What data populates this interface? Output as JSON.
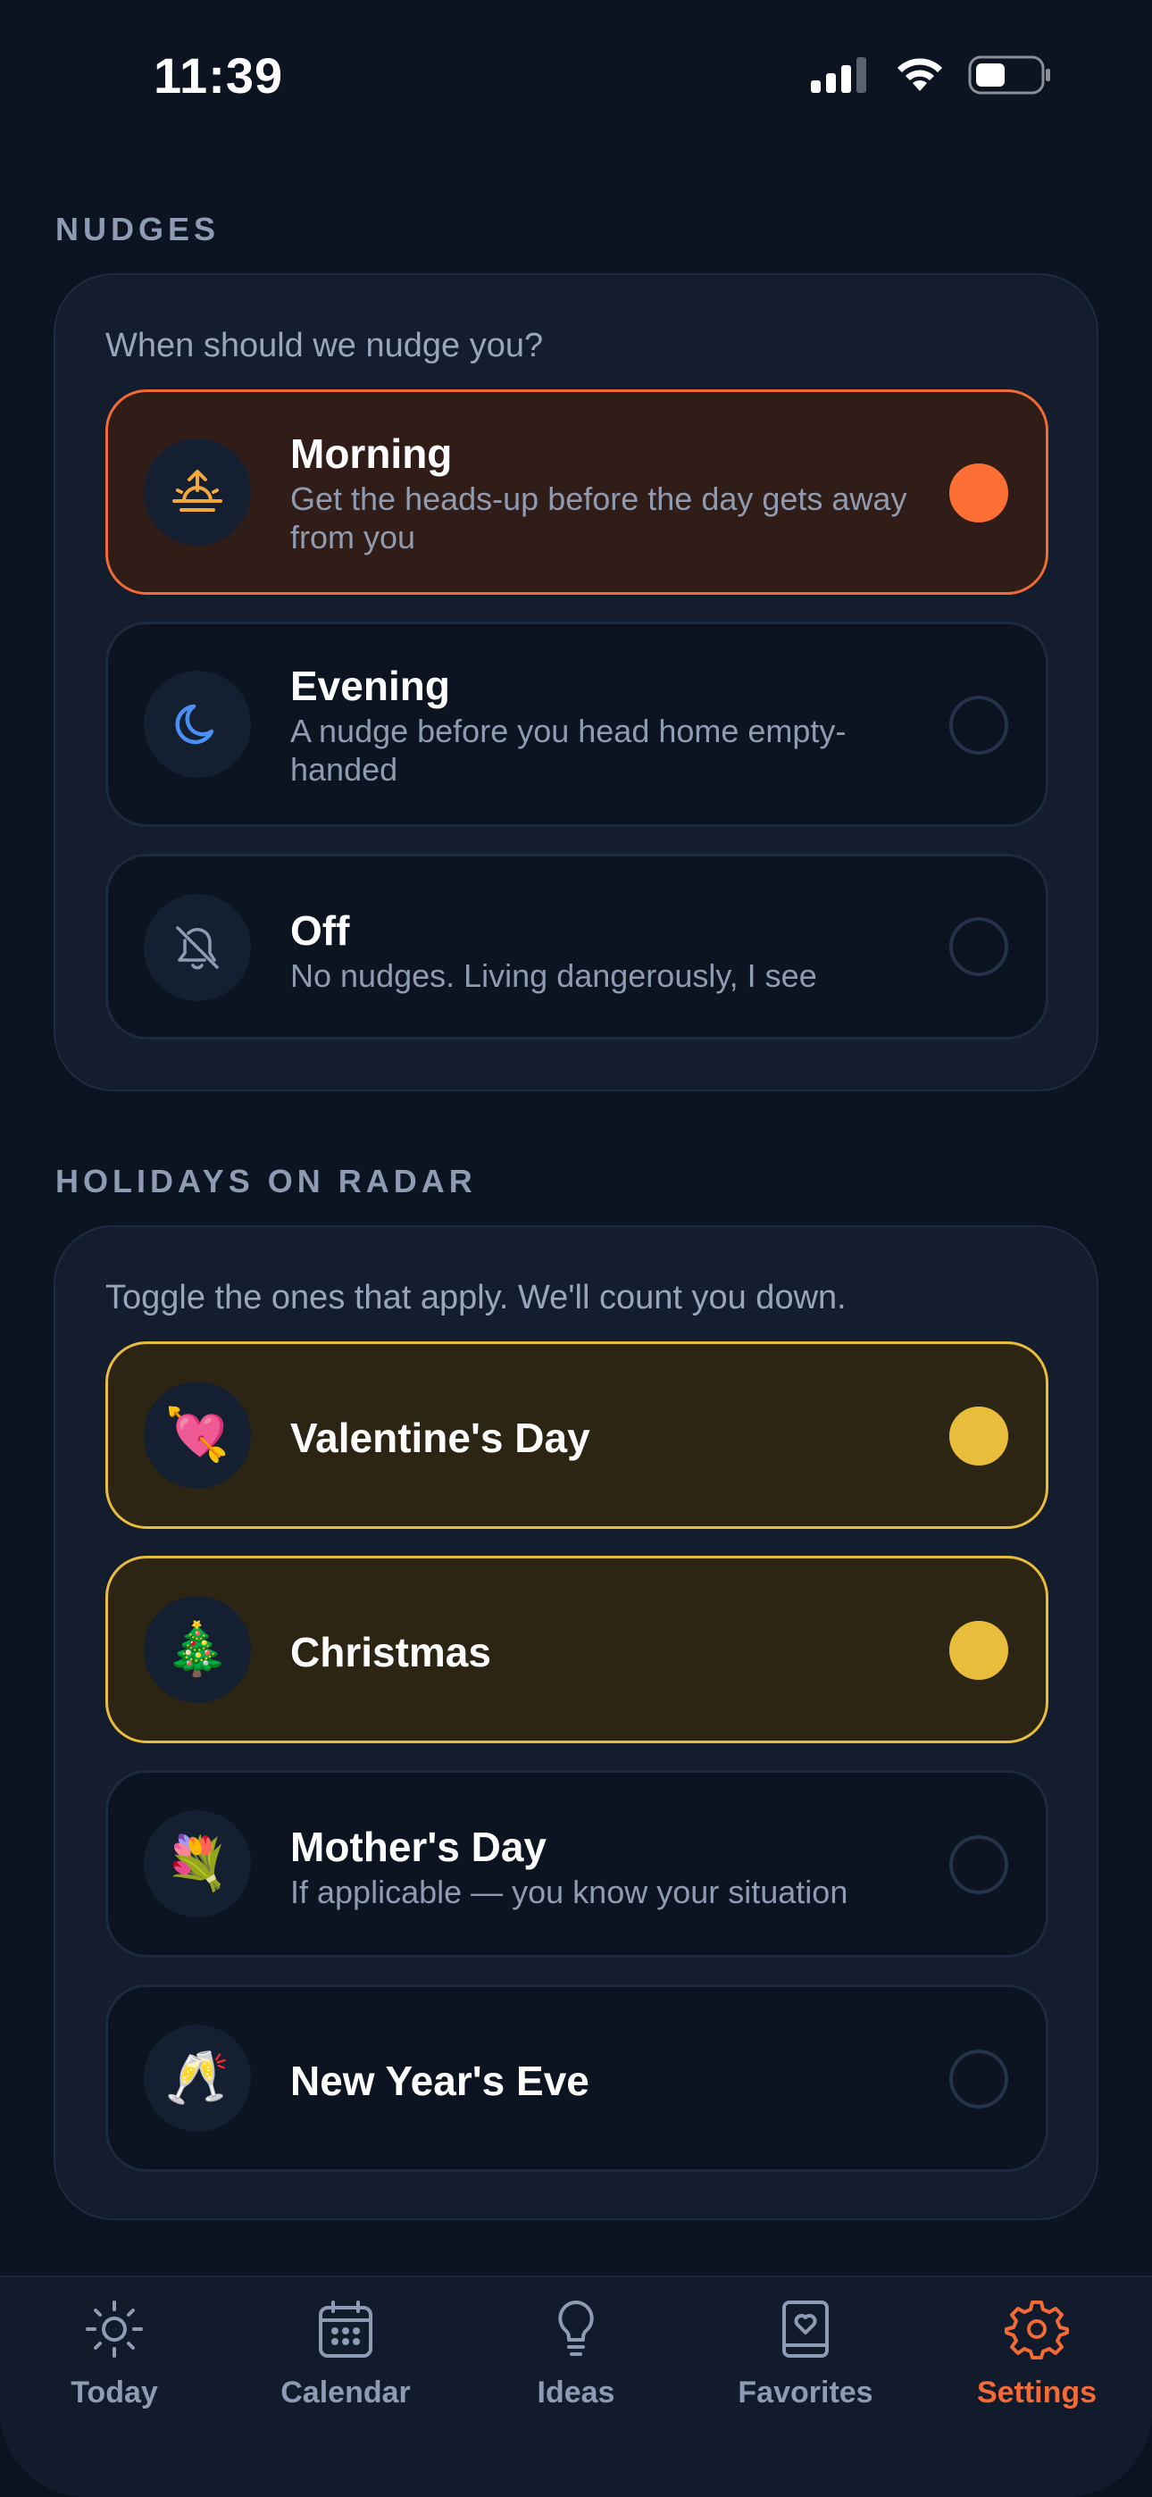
{
  "status_bar": {
    "time": "11:39"
  },
  "nudges": {
    "header": "NUDGES",
    "subtitle": "When should we nudge you?",
    "options": [
      {
        "title": "Morning",
        "description": "Get the heads-up before the day gets away from you",
        "icon": "sunrise-icon",
        "selected": true
      },
      {
        "title": "Evening",
        "description": "A nudge before you head home empty-handed",
        "icon": "moon-icon",
        "selected": false
      },
      {
        "title": "Off",
        "description": "No nudges. Living dangerously, I see",
        "icon": "bell-off-icon",
        "selected": false
      }
    ]
  },
  "holidays": {
    "header": "HOLIDAYS ON RADAR",
    "subtitle": "Toggle the ones that apply. We'll count you down.",
    "items": [
      {
        "title": "Valentine's Day",
        "emoji": "💘",
        "description": "",
        "enabled": true
      },
      {
        "title": "Christmas",
        "emoji": "🎄",
        "description": "",
        "enabled": true
      },
      {
        "title": "Mother's Day",
        "emoji": "💐",
        "description": "If applicable — you know your situation",
        "enabled": false
      },
      {
        "title": "New Year's Eve",
        "emoji": "🥂",
        "description": "",
        "enabled": false
      }
    ]
  },
  "tabs": [
    {
      "label": "Today",
      "icon": "sun-icon",
      "active": false
    },
    {
      "label": "Calendar",
      "icon": "calendar-icon",
      "active": false
    },
    {
      "label": "Ideas",
      "icon": "lightbulb-icon",
      "active": false
    },
    {
      "label": "Favorites",
      "icon": "heart-book-icon",
      "active": false
    },
    {
      "label": "Settings",
      "icon": "gear-icon",
      "active": true
    }
  ],
  "colors": {
    "accent_orange": "#fb6f35",
    "accent_yellow": "#e8bd3c",
    "background": "#0c1422",
    "card": "#131d2e"
  }
}
